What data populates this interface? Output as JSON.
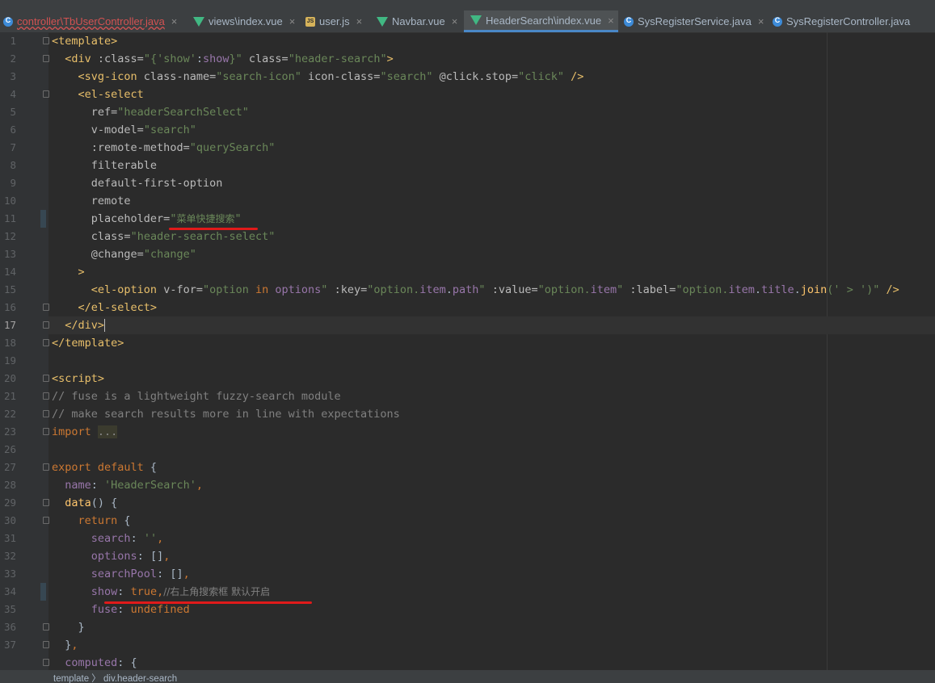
{
  "tabs": [
    {
      "label": "controller\\TbUserController.java",
      "icon": "java-class-icon"
    },
    {
      "label": "views\\index.vue",
      "icon": "vue-icon"
    },
    {
      "label": "user.js",
      "icon": "js-icon"
    },
    {
      "label": "Navbar.vue",
      "icon": "vue-icon"
    },
    {
      "label": "HeaderSearch\\index.vue",
      "icon": "vue-icon",
      "active": true
    },
    {
      "label": "SysRegisterService.java",
      "icon": "java-class-icon"
    },
    {
      "label": "SysRegisterController.java",
      "icon": "java-class-icon"
    }
  ],
  "close_glyph": "×",
  "line_numbers": [
    "1",
    "2",
    "3",
    "4",
    "5",
    "6",
    "7",
    "8",
    "9",
    "10",
    "11",
    "12",
    "13",
    "14",
    "15",
    "16",
    "17",
    "18",
    "19",
    "20",
    "21",
    "22",
    "23",
    "26",
    "27",
    "28",
    "29",
    "30",
    "31",
    "32",
    "33",
    "34",
    "35",
    "36",
    "37"
  ],
  "code": {
    "l1": {
      "a": "<template>"
    },
    "l2": {
      "a": "<div",
      "b": " :class=",
      "c": "\"{",
      "d": "'show'",
      "e": ":",
      "f": "show",
      "g": "}\"",
      "h": " class=",
      "i": "\"header-search\"",
      "j": ">"
    },
    "l3": {
      "a": "<svg-icon",
      "b": " class-name=",
      "c": "\"search-icon\"",
      "d": " icon-class=",
      "e": "\"search\"",
      "f": " @click.stop=",
      "g": "\"click\"",
      "h": " />"
    },
    "l4": {
      "a": "<el-select"
    },
    "l5": {
      "a": "ref=",
      "b": "\"headerSearchSelect\""
    },
    "l6": {
      "a": "v-model=",
      "b": "\"search\""
    },
    "l7": {
      "a": ":remote-method=",
      "b": "\"querySearch\""
    },
    "l8": {
      "a": "filterable"
    },
    "l9": {
      "a": "default-first-option"
    },
    "l10": {
      "a": "remote"
    },
    "l11": {
      "a": "placeholder=",
      "b": "\"",
      "c": "菜单快捷搜索",
      "d": "\""
    },
    "l12": {
      "a": "class=",
      "b": "\"header-search-select\""
    },
    "l13": {
      "a": "@change=",
      "b": "\"change\""
    },
    "l14": {
      "a": ">"
    },
    "l15": {
      "a": "<el-option",
      "b": " v-for=",
      "c": "\"option ",
      "d": "in",
      "e": " options",
      "f": "\"",
      "g": " :key=",
      "h": "\"option.",
      "i": "item",
      "j": ".",
      "k": "path",
      "l": "\"",
      "m": " :value=",
      "n": "\"option.",
      "o": "item",
      "p": "\"",
      "q": " :label=",
      "r": "\"option.",
      "s": "item",
      "t": ".",
      "u": "title",
      "v": ".",
      "w": "join",
      "x": "('",
      "y": " > ",
      "z": "')\"",
      "zz": " />"
    },
    "l16": {
      "a": "</el-select>"
    },
    "l17": {
      "a": "</div>"
    },
    "l18": {
      "a": "</template>"
    },
    "l20": {
      "a": "<script>"
    },
    "l21": {
      "a": "// fuse is a lightweight fuzzy-search module"
    },
    "l22": {
      "a": "// make search results more in line with expectations"
    },
    "l23": {
      "a": "import",
      "b": " ",
      "c": "..."
    },
    "l26": {
      "a": "export default",
      "b": " {"
    },
    "l27": {
      "a": "name",
      "b": ": ",
      "c": "'HeaderSearch'",
      "d": ","
    },
    "l28": {
      "a": "data",
      "b": "() {"
    },
    "l29": {
      "a": "return",
      "b": " {"
    },
    "l30": {
      "a": "search",
      "b": ": ",
      "c": "''",
      "d": ","
    },
    "l31": {
      "a": "options",
      "b": ": []",
      "c": ","
    },
    "l32": {
      "a": "searchPool",
      "b": ": []",
      "c": ","
    },
    "l33": {
      "a": "show",
      "b": ": ",
      "c": "true",
      "d": ",",
      "e": "//右上角搜索框 默认开启"
    },
    "l34": {
      "a": "fuse",
      "b": ": ",
      "c": "undefined"
    },
    "l35": {
      "a": "}"
    },
    "l36": {
      "a": "}",
      "b": ","
    },
    "l37": {
      "a": "computed",
      "b": ": {"
    }
  },
  "status": {
    "breadcrumb": "template  〉 div.header-search"
  },
  "colors": {
    "underline": "#e01a1a",
    "accent": "#4a88c7"
  }
}
